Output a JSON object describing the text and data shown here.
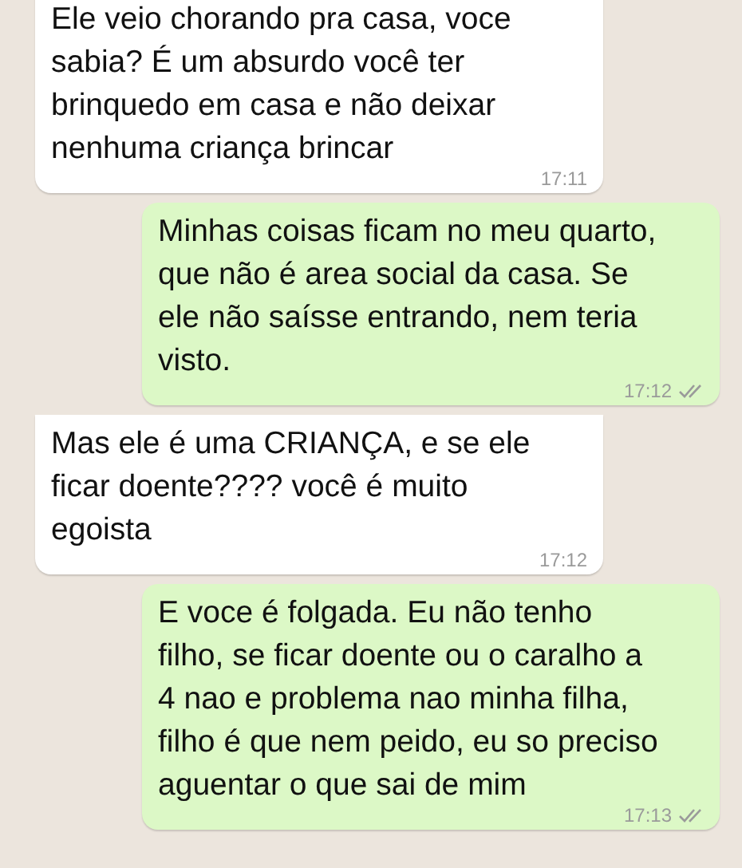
{
  "messages": [
    {
      "kind": "incoming",
      "text": "Ele veio chorando pra casa, voce sabia? É um absurdo você ter brinquedo em casa e não deixar nenhuma criança brincar",
      "time": "17:11"
    },
    {
      "kind": "outgoing",
      "text": "Minhas coisas ficam no meu quarto, que não é area social da casa. Se ele não saísse entrando, nem teria visto.",
      "time": "17:12",
      "read": false
    },
    {
      "kind": "incoming",
      "text": "Mas ele é uma CRIANÇA, e se ele ficar doente???? você é muito egoista",
      "time": "17:12"
    },
    {
      "kind": "outgoing",
      "text": "E voce é folgada. Eu não tenho filho, se ficar doente ou o caralho a 4 nao e problema nao minha filha, filho é que nem peido, eu so preciso aguentar o que sai de mim",
      "time": "17:13",
      "read": false
    }
  ]
}
